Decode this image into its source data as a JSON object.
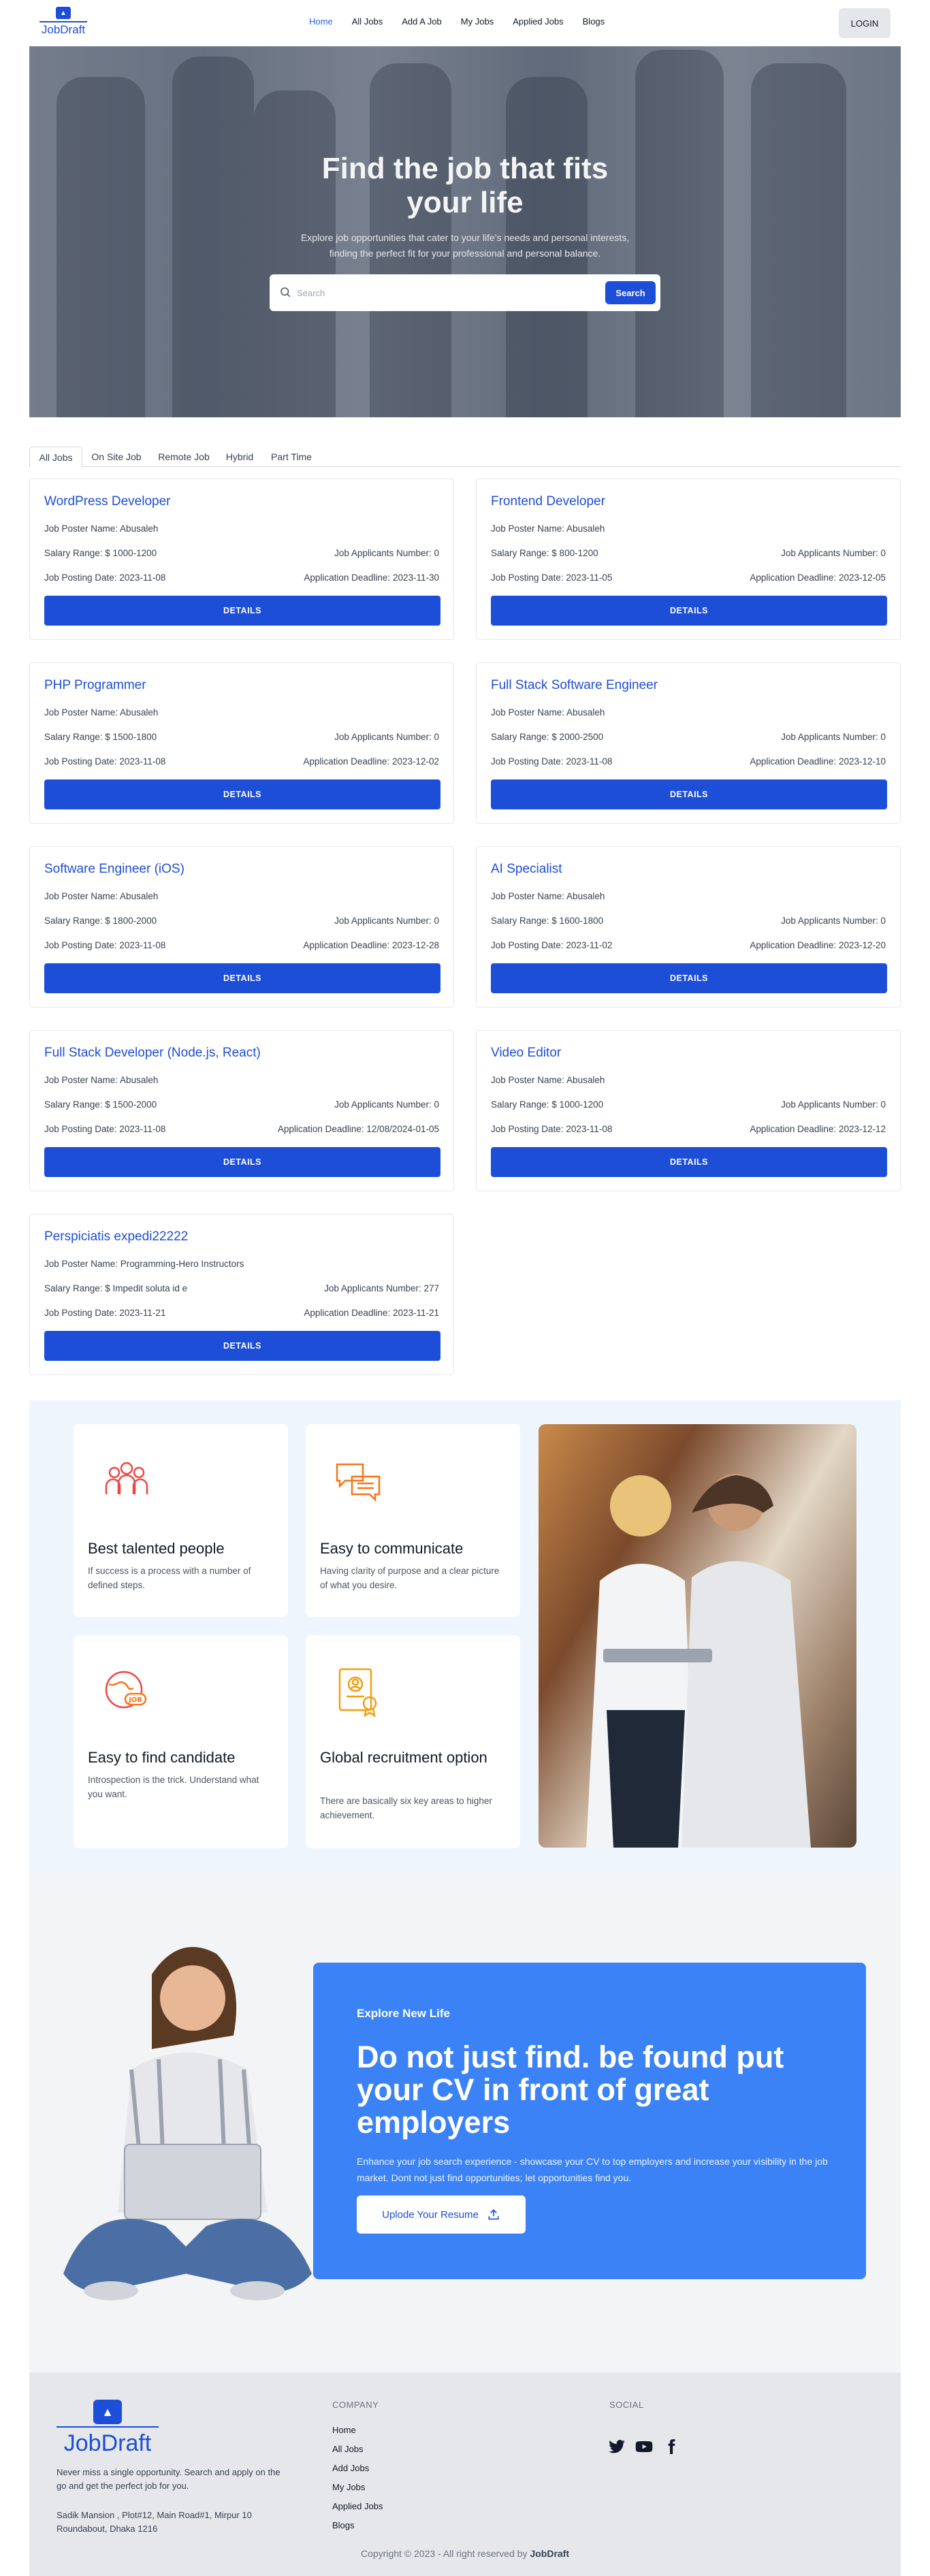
{
  "nav": {
    "brand": "JobDraft",
    "links": [
      "Home",
      "All Jobs",
      "Add A Job",
      "My Jobs",
      "Applied Jobs",
      "Blogs"
    ],
    "active": "Home",
    "login": "LOGIN"
  },
  "hero": {
    "title_line1": "Find the job that fits",
    "title_line2": "your life",
    "subtitle_line1": "Explore job opportunities that cater to your life's needs and personal interests,",
    "subtitle_line2": "finding the perfect fit for your professional and personal balance.",
    "search_placeholder": "Search",
    "search_button": "Search"
  },
  "tabs": [
    "All Jobs",
    "On Site Job",
    "Remote Job",
    "Hybrid",
    "Part Time"
  ],
  "jobs": [
    {
      "title": "WordPress Developer",
      "poster": "Job Poster Name: Abusaleh",
      "salary": "Salary Range: $ 1000-1200",
      "applicants": "Job Applicants Number: 0",
      "posted": "Job Posting Date: 2023-11-08",
      "deadline": "Application Deadline: 2023-11-30",
      "button": "DETAILS"
    },
    {
      "title": "Frontend Developer",
      "poster": "Job Poster Name: Abusaleh",
      "salary": "Salary Range: $ 800-1200",
      "applicants": "Job Applicants Number: 0",
      "posted": "Job Posting Date: 2023-11-05",
      "deadline": "Application Deadline: 2023-12-05",
      "button": "DETAILS"
    },
    {
      "title": "PHP Programmer",
      "poster": "Job Poster Name: Abusaleh",
      "salary": "Salary Range: $ 1500-1800",
      "applicants": "Job Applicants Number: 0",
      "posted": "Job Posting Date: 2023-11-08",
      "deadline": "Application Deadline: 2023-12-02",
      "button": "DETAILS"
    },
    {
      "title": "Full Stack Software Engineer",
      "poster": "Job Poster Name: Abusaleh",
      "salary": "Salary Range: $ 2000-2500",
      "applicants": "Job Applicants Number: 0",
      "posted": "Job Posting Date: 2023-11-08",
      "deadline": "Application Deadline: 2023-12-10",
      "button": "DETAILS"
    },
    {
      "title": "Software Engineer (iOS)",
      "poster": "Job Poster Name: Abusaleh",
      "salary": "Salary Range: $ 1800-2000",
      "applicants": "Job Applicants Number: 0",
      "posted": "Job Posting Date: 2023-11-08",
      "deadline": "Application Deadline: 2023-12-28",
      "button": "DETAILS"
    },
    {
      "title": "AI Specialist",
      "poster": "Job Poster Name: Abusaleh",
      "salary": "Salary Range: $ 1600-1800",
      "applicants": "Job Applicants Number: 0",
      "posted": "Job Posting Date: 2023-11-02",
      "deadline": "Application Deadline: 2023-12-20",
      "button": "DETAILS"
    },
    {
      "title": "Full Stack Developer (Node.js, React)",
      "poster": "Job Poster Name: Abusaleh",
      "salary": "Salary Range: $ 1500-2000",
      "applicants": "Job Applicants Number: 0",
      "posted": "Job Posting Date: 2023-11-08",
      "deadline": "Application Deadline: 12/08/2024-01-05",
      "button": "DETAILS"
    },
    {
      "title": "Video Editor",
      "poster": "Job Poster Name: Abusaleh",
      "salary": "Salary Range: $ 1000-1200",
      "applicants": "Job Applicants Number: 0",
      "posted": "Job Posting Date: 2023-11-08",
      "deadline": "Application Deadline: 2023-12-12",
      "button": "DETAILS"
    },
    {
      "title": "Perspiciatis expedi22222",
      "poster": "Job Poster Name: Programming-Hero Instructors",
      "salary": "Salary Range: $ Impedit soluta id e",
      "applicants": "Job Applicants Number: 277",
      "posted": "Job Posting Date: 2023-11-21",
      "deadline": "Application Deadline: 2023-11-21",
      "button": "DETAILS"
    }
  ],
  "features": [
    {
      "icon": "team-icon",
      "title": "Best talented people",
      "desc": "If success is a process with a number of defined steps."
    },
    {
      "icon": "chat-icon",
      "title": "Easy to communicate",
      "desc": "Having clarity of purpose and a clear picture of what you desire."
    },
    {
      "icon": "globe-job-icon",
      "title": "Easy to find candidate",
      "desc": "Introspection is the trick. Understand what you want."
    },
    {
      "icon": "resume-badge-icon",
      "title": "Global recruitment option",
      "desc": "There are basically six key areas to higher achievement."
    }
  ],
  "cta": {
    "eyebrow": "Explore New Life",
    "title": "Do not just find. be found put your CV in front of great employers",
    "desc": "Enhance your job search experience - showcase your CV to top employers and increase your visibility in the job market. Dont not just find opportunities; let opportunities find you.",
    "button": "Uplode Your Resume"
  },
  "footer": {
    "brand": "JobDraft",
    "about": "Never miss a single opportunity. Search and apply on the go and get the perfect job for you.",
    "address": "Sadik Mansion , Plot#12, Main Road#1, Mirpur 10 Roundabout, Dhaka 1216",
    "company_title": "COMPANY",
    "company_links": [
      "Home",
      "All Jobs",
      "Add Jobs",
      "My Jobs",
      "Applied Jobs",
      "Blogs"
    ],
    "social_title": "SOCIAL",
    "social_icons": [
      "twitter-icon",
      "youtube-icon",
      "facebook-icon"
    ],
    "copyright_prefix": "Copyright © 2023 - All right reserved by",
    "copyright_brand": "JobDraft"
  },
  "colors": {
    "primary": "#1d4ed8",
    "cta_bg": "#3b82f6",
    "features_bg": "#eef5fd",
    "footer_bg": "#e5e7eb",
    "icon_orange": "#f97316",
    "icon_red": "#ef4444"
  }
}
